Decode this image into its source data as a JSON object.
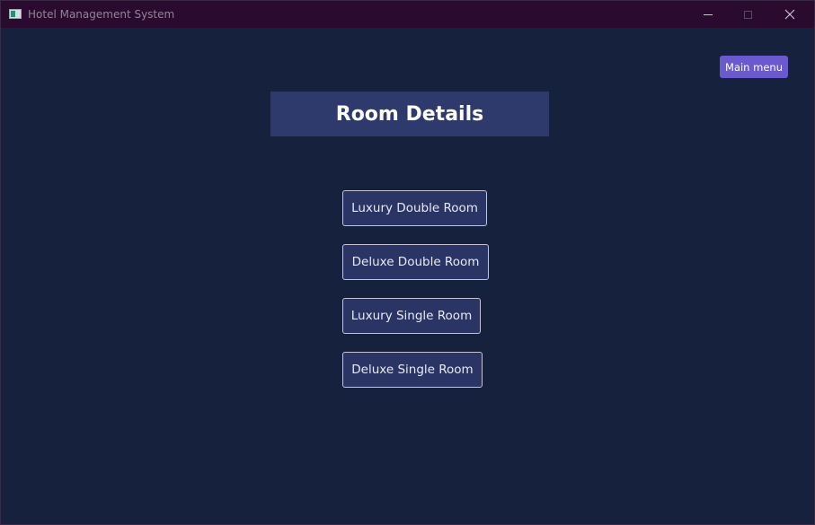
{
  "window": {
    "title": "Hotel Management System",
    "icon": "app-window-icon",
    "controls": [
      "minimize-icon",
      "maximize-icon",
      "close-icon"
    ]
  },
  "header": {
    "main_menu_label": "Main menu",
    "page_title": "Room Details"
  },
  "rooms": [
    {
      "label": "Luxury Double Room"
    },
    {
      "label": "Deluxe Double Room"
    },
    {
      "label": "Luxury Single Room"
    },
    {
      "label": "Deluxe Single Room"
    }
  ],
  "colors": {
    "titlebar": "#2a0a2e",
    "background": "#16213e",
    "title_banner": "#2d3a6b",
    "accent": "#6a5acd",
    "room_button": "#2a3566"
  }
}
